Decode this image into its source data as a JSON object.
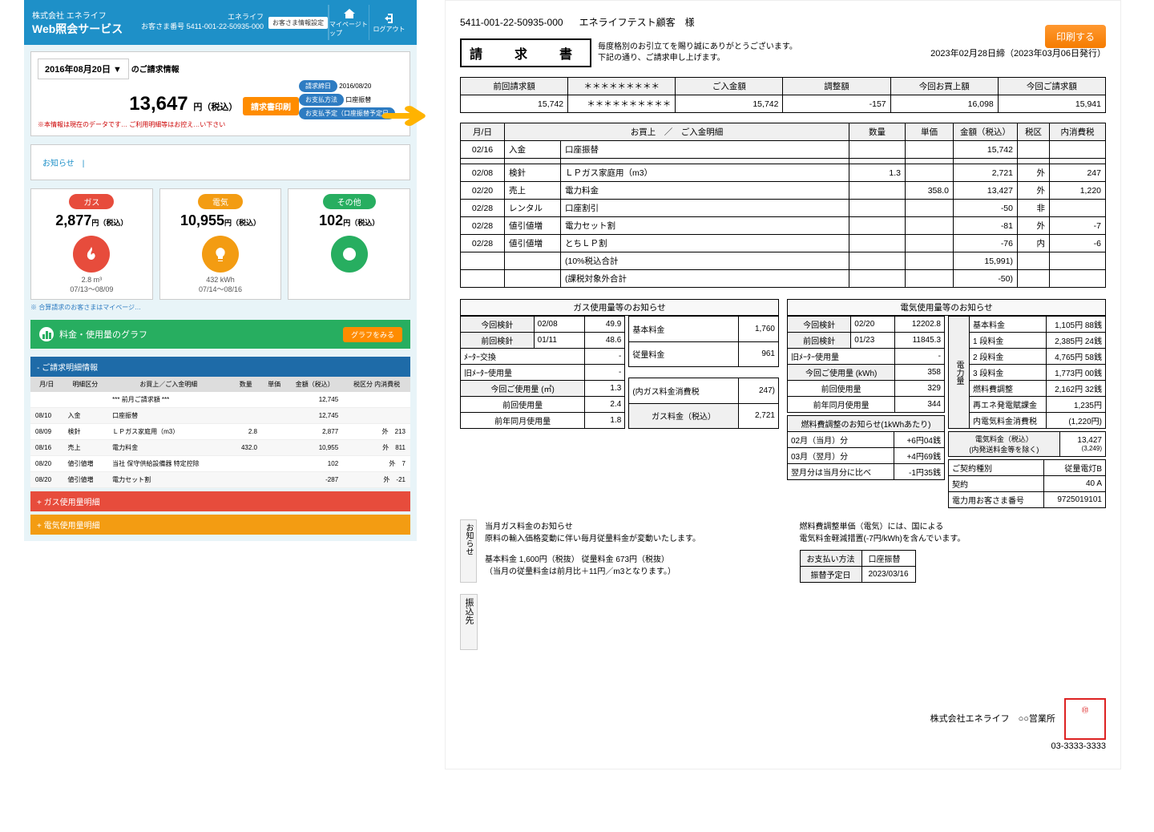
{
  "left": {
    "company": "株式会社 エネライフ",
    "service": "Web照会サービス",
    "customer_label": "エネライフ",
    "customer_no_label": "お客さま番号 5411-001-22-50935-000",
    "settings_btn": "お客さま情報設定",
    "mypage": "マイページトップ",
    "logout": "ログアウト",
    "bill_date": "2016年08月20日",
    "bill_date_suffix": "のご請求情報",
    "bill_amount": "13,647",
    "bill_unit": "円（税込）",
    "print_btn": "請求書印刷",
    "tag1": "請求締日",
    "tag1v": "2016/08/20",
    "tag2": "お支払方法",
    "tag2v": "口座振替",
    "tag3": "お支払予定（口座振替予定日",
    "bill_note": "※本情報は現在のデータです… ご利用明細等はお控え…い下さい",
    "notice_label": "お知らせ",
    "cats": {
      "gas": {
        "label": "ガス",
        "price": "2,877",
        "unit": "円（税込）",
        "meta1": "2.8 m³",
        "meta2": "07/13～08/09"
      },
      "elec": {
        "label": "電気",
        "price": "10,955",
        "unit": "円（税込）",
        "meta1": "432 kWh",
        "meta2": "07/14～08/16"
      },
      "other": {
        "label": "その他",
        "price": "102",
        "unit": "円（税込）"
      }
    },
    "cats_note": "※ 合算請求のお客さまはマイページ…",
    "graph_title": "料金・使用量のグラフ",
    "graph_btn": "グラフをみる",
    "detail_header": "- ご請求明細情報",
    "detail_cols": [
      "月/日",
      "明細区分",
      "お買上／ご入金明細",
      "数量",
      "単価",
      "金額（税込）",
      "税区分 内消費税"
    ],
    "detail_rows": [
      [
        "",
        "",
        "*** 前月ご請求額 ***",
        "",
        "",
        "12,745",
        ""
      ],
      [
        "08/10",
        "入金",
        "口座振替",
        "",
        "",
        "12,745",
        ""
      ],
      [
        "08/09",
        "検針",
        "ＬＰガス家庭用（m3）",
        "2.8",
        "",
        "2,877",
        "外　213"
      ],
      [
        "08/16",
        "売上",
        "電力料金",
        "432.0",
        "",
        "10,955",
        "外　811"
      ],
      [
        "08/20",
        "値引値増",
        "当社 保守供給設備器 特定控除",
        "",
        "",
        "102",
        "外　7"
      ],
      [
        "08/20",
        "値引値増",
        "電力セット割",
        "",
        "",
        "-287",
        "外　-21"
      ]
    ],
    "acc_gas": "+ ガス使用量明細",
    "acc_elec": "+ 電気使用量明細"
  },
  "right": {
    "acct_no": "5411-001-22-50935-000",
    "customer": "エネライフテスト顧客　様",
    "print": "印刷する",
    "title": "請　求　書",
    "greet1": "毎度格別のお引立てを賜り誠にありがとうございます。",
    "greet2": "下記の通り、ご請求申し上げます。",
    "date": "2023年02月28日締（2023年03月06日発行）",
    "sum_headers": [
      "前回請求額",
      "＊＊＊＊＊＊＊＊＊",
      "ご入金額",
      "調整額",
      "今回お買上額",
      "今回ご請求額"
    ],
    "sum_values": [
      "15,742",
      "＊＊＊＊＊＊＊＊＊＊",
      "15,742",
      "-157",
      "16,098",
      "15,941"
    ],
    "line_headers": [
      "月/日",
      "お買上　／　ご入金明細",
      "",
      "数量",
      "単価",
      "金額（税込）",
      "税区",
      "内消費税"
    ],
    "line_rows": [
      [
        "02/16",
        "入金",
        "口座振替",
        "",
        "",
        "15,742",
        "",
        ""
      ],
      [
        "",
        "",
        "",
        "",
        "",
        "",
        "",
        ""
      ],
      [
        "02/08",
        "検針",
        "ＬＰガス家庭用（m3）",
        "1.3",
        "",
        "2,721",
        "外",
        "247"
      ],
      [
        "02/20",
        "売上",
        "電力料金",
        "",
        "358.0",
        "13,427",
        "外",
        "1,220"
      ],
      [
        "02/28",
        "レンタル",
        "口座割引",
        "",
        "",
        "-50",
        "非",
        ""
      ],
      [
        "02/28",
        "値引値増",
        "電力セット割",
        "",
        "",
        "-81",
        "外",
        "-7"
      ],
      [
        "02/28",
        "値引値増",
        "とちＬＰ割",
        "",
        "",
        "-76",
        "内",
        "-6"
      ],
      [
        "",
        "",
        "(10%税込合計",
        "",
        "",
        "15,991)",
        "",
        ""
      ],
      [
        "",
        "",
        "(課税対象外合計",
        "",
        "",
        "-50)",
        "",
        ""
      ]
    ],
    "gas_notice": "ガス使用量等のお知らせ",
    "elec_notice": "電気使用量等のお知らせ",
    "gas": {
      "now_read": [
        "今回検針",
        "02/08",
        "49.9"
      ],
      "prev_read": [
        "前回検針",
        "01/11",
        "48.6"
      ],
      "meter_change": [
        "ﾒｰﾀｰ交換",
        "",
        "-"
      ],
      "old_meter": [
        "旧ﾒｰﾀｰ使用量",
        "",
        "-"
      ],
      "now_use": [
        "今回ご使用量 (㎥)",
        "",
        "1.3"
      ],
      "prev_use": [
        "前回使用量",
        "",
        "2.4"
      ],
      "same_month": [
        "前年同月使用量",
        "",
        "1.8"
      ],
      "basic": [
        "基本料金",
        "1,760"
      ],
      "unit": [
        "従量料金",
        "961"
      ],
      "tax_in": [
        "(内ガス料金消費税",
        "247)"
      ],
      "total": [
        "ガス料金（税込）",
        "2,721"
      ]
    },
    "elec": {
      "now_read": [
        "今回検針",
        "02/20",
        "12202.8"
      ],
      "prev_read": [
        "前回検針",
        "01/23",
        "11845.3"
      ],
      "old_meter": [
        "旧ﾒｰﾀｰ使用量",
        "",
        "-"
      ],
      "now_use": [
        "今回ご使用量 (kWh)",
        "",
        "358"
      ],
      "prev_use": [
        "前回使用量",
        "",
        "329"
      ],
      "same_month": [
        "前年同月使用量",
        "",
        "344"
      ],
      "adj_header": "燃料費調整のお知らせ(1kWhあたり)",
      "adj": [
        [
          "02月（当月）分",
          "+6円04銭"
        ],
        [
          "03月（翌月）分",
          "+4円69銭"
        ],
        [
          "翌月分は当月分に比べ",
          "-1円35銭"
        ]
      ],
      "breakdown_header": "電力量",
      "breakdown": [
        [
          "基本料金",
          "1,105円 88銭"
        ],
        [
          "1 段料金",
          "2,385円 24銭"
        ],
        [
          "2 段料金",
          "4,765円 58銭"
        ],
        [
          "3 段料金",
          "1,773円 00銭"
        ],
        [
          "燃料費調整",
          "2,162円 32銭"
        ],
        [
          "再エネ発電賦課金",
          "1,235円"
        ],
        [
          "内電気料金消費税",
          "(1,220円)"
        ]
      ],
      "total": [
        "電気料金（税込）\n(内発送料金等を除く)",
        "13,427",
        "(3,249)"
      ],
      "contract": [
        [
          "ご契約種別",
          "従量電灯B"
        ],
        [
          "契約",
          "40 A"
        ],
        [
          "電力用お客さま番号",
          "9725019101"
        ]
      ]
    },
    "info_label": "お知らせ",
    "info_gas_title": "当月ガス料金のお知らせ",
    "info_gas_body": "原料の輸入価格変動に伴い毎月従量料金が変動いたします。",
    "info_gas_body2": "基本料金 1,600円（税抜） 従量料金 673円（税抜）",
    "info_gas_body3": "（当月の従量料金は前月比＋11円／m3となります。）",
    "info_elec_body": "燃料費調整単価（電気）には、国による\n電気料金軽減措置(-7円/kWh)を含んでいます。",
    "payment": [
      [
        "お支払い方法",
        "口座振替"
      ],
      [
        "振替予定日",
        "2023/03/16"
      ]
    ],
    "transfer_label": "振込先",
    "footer1": "株式会社エネライフ　○○営業所",
    "footer2": "03-3333-3333"
  }
}
